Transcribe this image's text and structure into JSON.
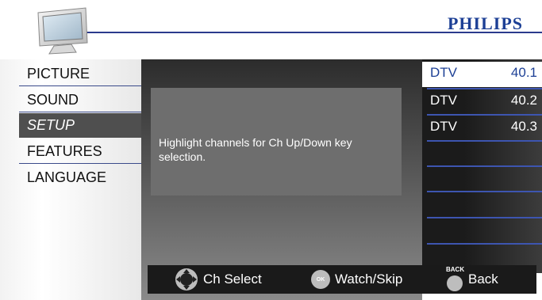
{
  "header": {
    "brand": "PHILIPS",
    "icons": {
      "tv": "tv-icon"
    },
    "colors": {
      "brand": "#1c3f95",
      "rule": "#2a3a8c"
    }
  },
  "left_menu": {
    "items": [
      {
        "label": "PICTURE",
        "selected": false
      },
      {
        "label": "SOUND",
        "selected": false
      },
      {
        "label": "SETUP",
        "selected": true
      },
      {
        "label": "FEATURES",
        "selected": false
      },
      {
        "label": "LANGUAGE",
        "selected": false
      }
    ]
  },
  "help": {
    "text": "Highlight channels for Ch Up/Down key selection."
  },
  "channels": [
    {
      "type": "DTV",
      "number": "40.1",
      "selected": true
    },
    {
      "type": "DTV",
      "number": "40.2",
      "selected": false
    },
    {
      "type": "DTV",
      "number": "40.3",
      "selected": false
    }
  ],
  "bottom_bar": {
    "ch_select": {
      "label": "Ch Select",
      "icon": "dpad-icon"
    },
    "watch_skip": {
      "label": "Watch/Skip",
      "icon": "ok-button-icon",
      "icon_text": "OK"
    },
    "back": {
      "label": "Back",
      "icon": "back-button-icon",
      "icon_text": "BACK"
    }
  }
}
